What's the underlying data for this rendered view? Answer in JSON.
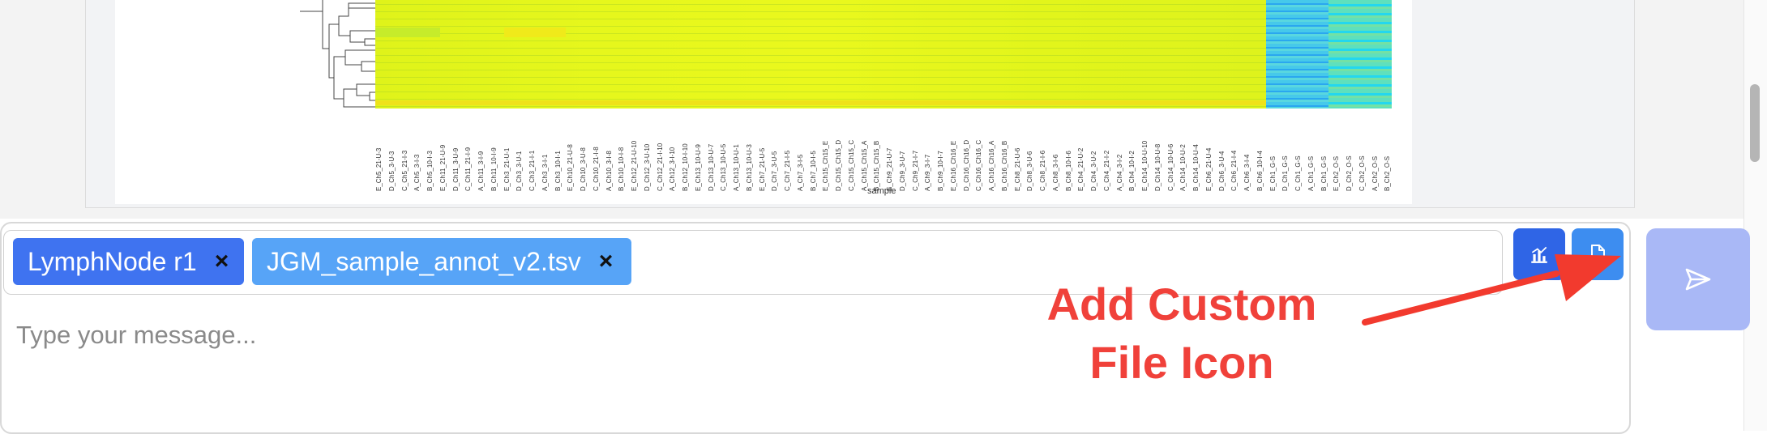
{
  "heatmap": {
    "x_axis_title": "sample",
    "column_labels": [
      "E_Ch5_21-U-3",
      "D_Ch5_3-U-3",
      "C_Ch5_21-I-3",
      "A_Ch5_3-I-3",
      "B_Ch5_10-I-3",
      "E_Ch11_21-U-9",
      "D_Ch11_3-U-9",
      "C_Ch11_21-I-9",
      "A_Ch11_3-I-9",
      "B_Ch11_10-I-9",
      "E_Ch3_21-U-1",
      "D_Ch3_3-U-1",
      "C_Ch3_21-I-1",
      "A_Ch3_3-I-1",
      "B_Ch3_10-I-1",
      "E_Ch10_21-U-8",
      "D_Ch10_3-U-8",
      "C_Ch10_21-I-8",
      "A_Ch10_3-I-8",
      "B_Ch10_10-I-8",
      "E_Ch12_21-U-10",
      "D_Ch12_3-U-10",
      "C_Ch12_21-I-10",
      "A_Ch12_3-I-10",
      "B_Ch12_10-I-10",
      "E_Ch13_10-U-9",
      "D_Ch13_10-U-7",
      "C_Ch13_10-U-5",
      "A_Ch13_10-U-1",
      "B_Ch13_10-U-3",
      "E_Ch7_21-U-5",
      "D_Ch7_3-U-5",
      "C_Ch7_21-I-5",
      "A_Ch7_3-I-5",
      "B_Ch7_10-I-5",
      "E_Ch15_Ch15_E",
      "D_Ch15_Ch15_D",
      "C_Ch15_Ch15_C",
      "A_Ch15_Ch15_A",
      "B_Ch15_Ch15_B",
      "E_Ch9_21-U-7",
      "D_Ch9_3-U-7",
      "C_Ch9_21-I-7",
      "A_Ch9_3-I-7",
      "B_Ch9_10-I-7",
      "E_Ch16_Ch16_E",
      "D_Ch16_Ch16_D",
      "C_Ch16_Ch16_C",
      "A_Ch16_Ch16_A",
      "B_Ch16_Ch16_B",
      "E_Ch8_21-U-6",
      "D_Ch8_3-U-6",
      "C_Ch8_21-I-6",
      "A_Ch8_3-I-6",
      "B_Ch8_10-I-6",
      "E_Ch4_21-U-2",
      "D_Ch4_3-U-2",
      "C_Ch4_21-I-2",
      "A_Ch4_3-I-2",
      "B_Ch4_10-I-2",
      "E_Ch14_10-U-10",
      "D_Ch14_10-U-8",
      "C_Ch14_10-U-6",
      "A_Ch14_10-U-2",
      "B_Ch14_10-U-4",
      "E_Ch6_21-U-4",
      "D_Ch6_3-U-4",
      "C_Ch6_21-I-4",
      "A_Ch6_3-I-4",
      "B_Ch6_10-I-4",
      "E_Ch1_G-S",
      "D_Ch1_G-S",
      "C_Ch1_G-S",
      "A_Ch1_G-S",
      "B_Ch1_G-S",
      "E_Ch2_O-S",
      "D_Ch2_O-S",
      "C_Ch2_O-S",
      "A_Ch2_O-S",
      "B_Ch2_O-S"
    ]
  },
  "chat": {
    "attachments": [
      {
        "label": "LymphNode r1",
        "remove": "×",
        "color": "#3f73f0"
      },
      {
        "label": "JGM_sample_annot_v2.tsv",
        "remove": "×",
        "color": "#57a4f7"
      }
    ],
    "message_placeholder": "Type your message...",
    "message_value": "",
    "buttons": {
      "chart_icon": "chart-icon",
      "file_icon": "file-icon",
      "send_icon": "send-icon"
    }
  },
  "annotation": {
    "text_line1": "Add Custom",
    "text_line2": "File Icon",
    "color": "#f0413a"
  }
}
